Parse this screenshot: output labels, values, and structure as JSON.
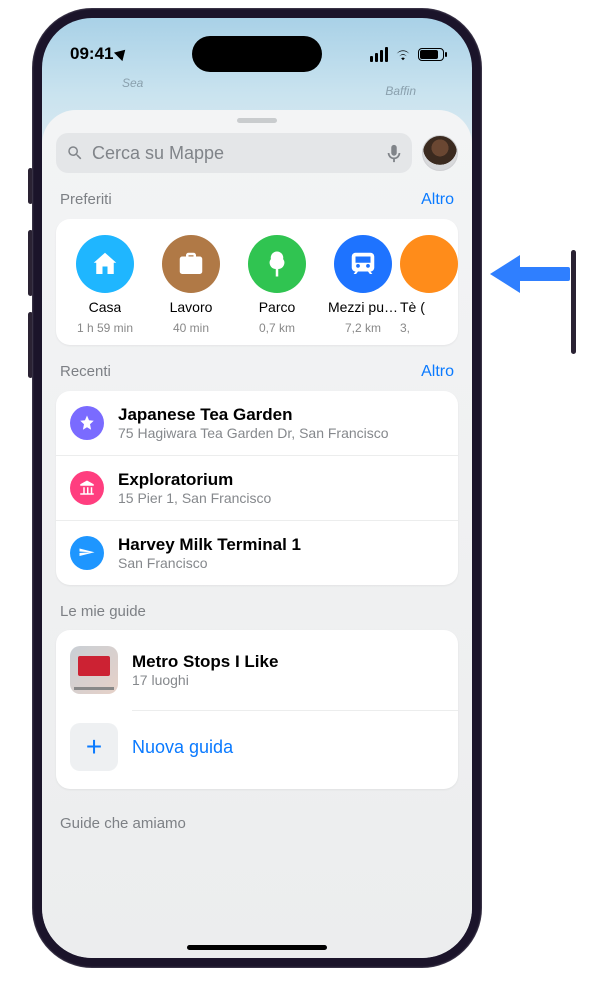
{
  "status": {
    "time": "09:41"
  },
  "search": {
    "placeholder": "Cerca su Mappe"
  },
  "sections": {
    "favorites": {
      "title": "Preferiti",
      "more": "Altro"
    },
    "recents": {
      "title": "Recenti",
      "more": "Altro"
    },
    "guides": {
      "title": "Le mie guide"
    },
    "guides_we_love": {
      "title": "Guide che amiamo"
    }
  },
  "favorites": [
    {
      "name": "Casa",
      "sub": "1 h 59 min",
      "kind": "home"
    },
    {
      "name": "Lavoro",
      "sub": "40 min",
      "kind": "work"
    },
    {
      "name": "Parco",
      "sub": "0,7 km",
      "kind": "park"
    },
    {
      "name": "Mezzi pu…",
      "sub": "7,2 km",
      "kind": "transit"
    },
    {
      "name": "Tè (",
      "sub": "3,",
      "kind": "tea"
    }
  ],
  "recents": [
    {
      "title": "Japanese Tea Garden",
      "sub": "75 Hagiwara Tea Garden Dr, San Francisco",
      "icon": "star"
    },
    {
      "title": "Exploratorium",
      "sub": "15 Pier 1, San Francisco",
      "icon": "museum"
    },
    {
      "title": "Harvey Milk Terminal 1",
      "sub": "San Francisco",
      "icon": "plane"
    }
  ],
  "guides": [
    {
      "title": "Metro Stops I Like",
      "sub": "17 luoghi"
    }
  ],
  "new_guide_label": "Nuova guida",
  "map_labels": {
    "sea": "Sea",
    "baffin": "Baffin"
  }
}
